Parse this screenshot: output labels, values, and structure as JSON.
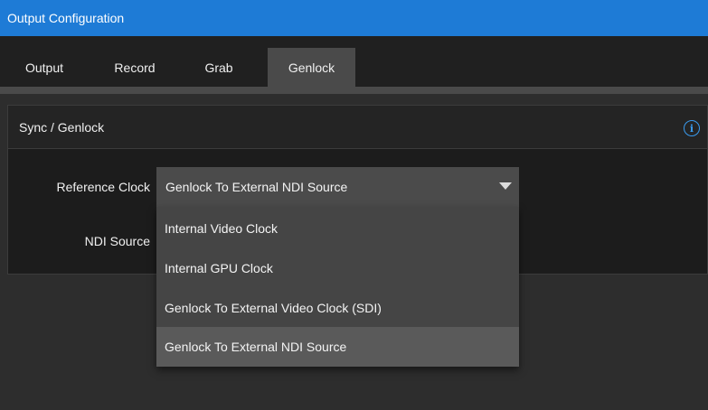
{
  "window": {
    "title": "Output Configuration"
  },
  "tabs": [
    {
      "label": "Output"
    },
    {
      "label": "Record"
    },
    {
      "label": "Grab"
    },
    {
      "label": "Genlock",
      "active": true
    }
  ],
  "panel": {
    "title": "Sync / Genlock",
    "info_icon": "i"
  },
  "fields": {
    "reference_clock": {
      "label": "Reference Clock",
      "value": "Genlock To External NDI Source"
    },
    "ndi_source": {
      "label": "NDI Source"
    }
  },
  "dropdown": {
    "options": [
      "Internal Video Clock",
      "Internal GPU Clock",
      "Genlock To External Video Clock (SDI)",
      "Genlock To External NDI Source"
    ],
    "selected_index": 3
  },
  "colors": {
    "accent": "#1e7bd6",
    "info": "#3a9cf0"
  }
}
